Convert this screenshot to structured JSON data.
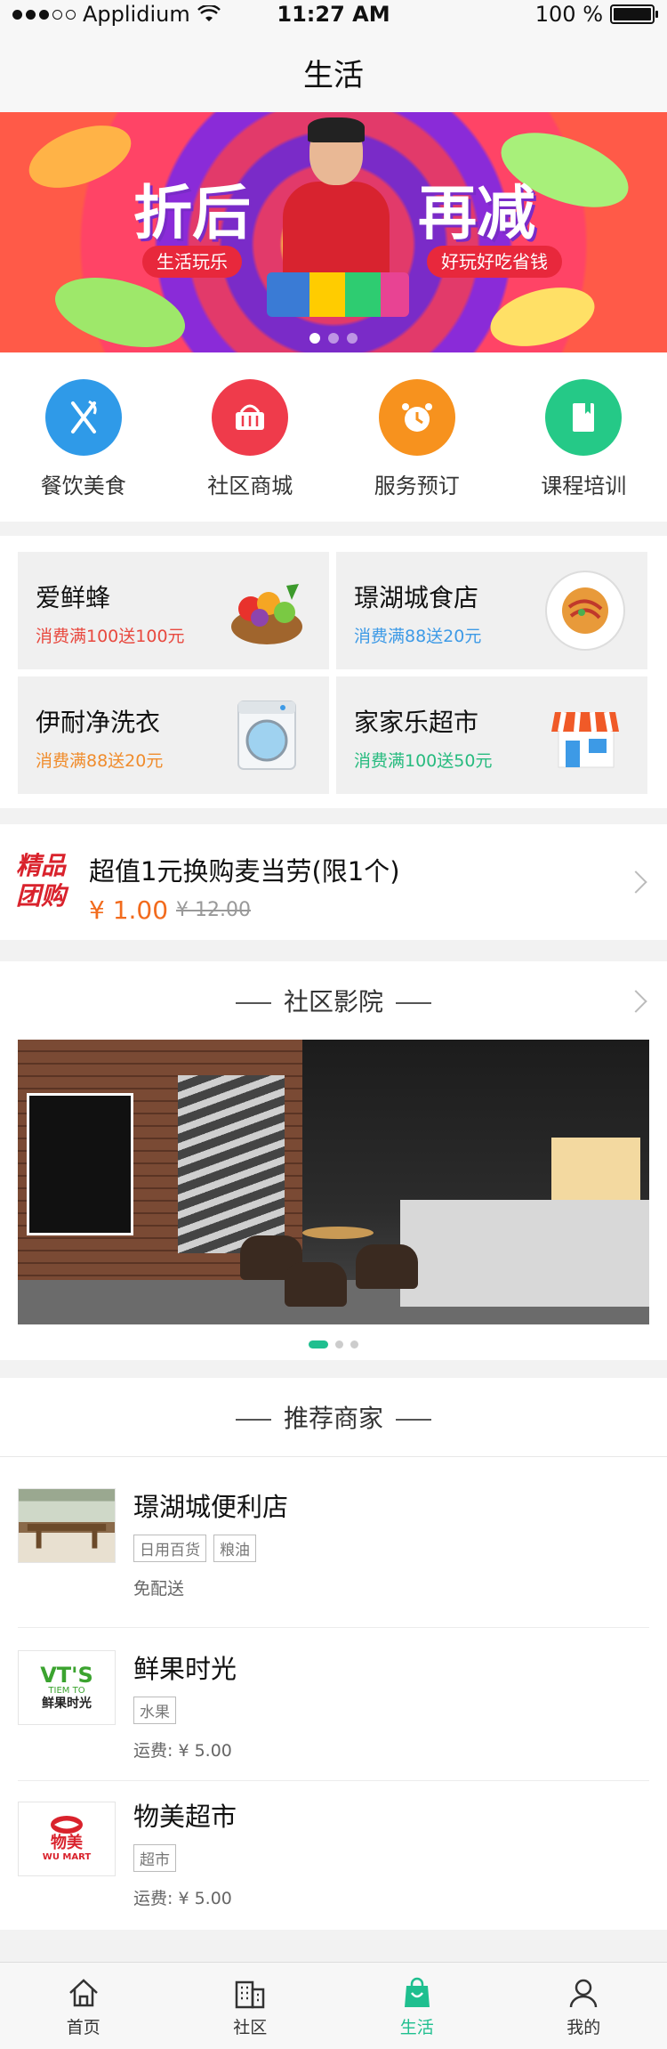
{
  "status_bar": {
    "carrier": "Applidium",
    "time": "11:27 AM",
    "battery": "100 %"
  },
  "nav": {
    "title": "生活"
  },
  "banner": {
    "left_big": "折后",
    "right_big": "再减",
    "left_tag": "生活玩乐",
    "right_tag": "好玩好吃省钱",
    "pages": 3,
    "active_page": 0
  },
  "services": [
    {
      "label": "餐饮美食",
      "icon": "fork-knife-icon",
      "color": "#2f9ae8"
    },
    {
      "label": "社区商城",
      "icon": "basket-icon",
      "color": "#ef3b4b"
    },
    {
      "label": "服务预订",
      "icon": "alarm-clock-icon",
      "color": "#f7921e"
    },
    {
      "label": "课程培训",
      "icon": "book-icon",
      "color": "#25c987"
    }
  ],
  "promos": [
    {
      "name": "爱鲜蜂",
      "desc": "消费满100送100元",
      "desc_color": "#e8493f",
      "pic": "fruit-basket-icon"
    },
    {
      "name": "璟湖城食店",
      "desc": "消费满88送20元",
      "desc_color": "#3d9ae6",
      "pic": "pasta-plate-icon"
    },
    {
      "name": "伊耐净洗衣",
      "desc": "消费满88送20元",
      "desc_color": "#f08c2c",
      "pic": "washing-machine-icon"
    },
    {
      "name": "家家乐超市",
      "desc": "消费满100送50元",
      "desc_color": "#27bb7f",
      "pic": "store-icon"
    }
  ],
  "group_buy": {
    "logo_line1": "精品",
    "logo_line2": "团购",
    "title": "超值1元换购麦当劳(限1个)",
    "price": "¥ 1.00",
    "original_price": "¥ 12.00"
  },
  "cinema": {
    "title": "社区影院",
    "pages": 3,
    "active_page": 0
  },
  "merchants": {
    "title": "推荐商家",
    "items": [
      {
        "name": "璟湖城便利店",
        "tags": [
          "日用百货",
          "粮油"
        ],
        "extra": "免配送"
      },
      {
        "name": "鲜果时光",
        "tags": [
          "水果"
        ],
        "extra": "运费: ¥ 5.00",
        "logo_top": "VT'S",
        "logo_mid": "TIEM TO",
        "logo_bottom": "鲜果时光"
      },
      {
        "name": "物美超市",
        "tags": [
          "超市"
        ],
        "extra": "运费: ¥ 5.00",
        "logo_top": "物美",
        "logo_bottom": "WU MART"
      }
    ]
  },
  "tabbar": [
    {
      "label": "首页",
      "icon": "home-icon",
      "active": false
    },
    {
      "label": "社区",
      "icon": "building-icon",
      "active": false
    },
    {
      "label": "生活",
      "icon": "shopping-bag-icon",
      "active": true
    },
    {
      "label": "我的",
      "icon": "user-icon",
      "active": false
    }
  ],
  "colors": {
    "accent": "#1fbf8f",
    "price": "#f26b1d"
  }
}
